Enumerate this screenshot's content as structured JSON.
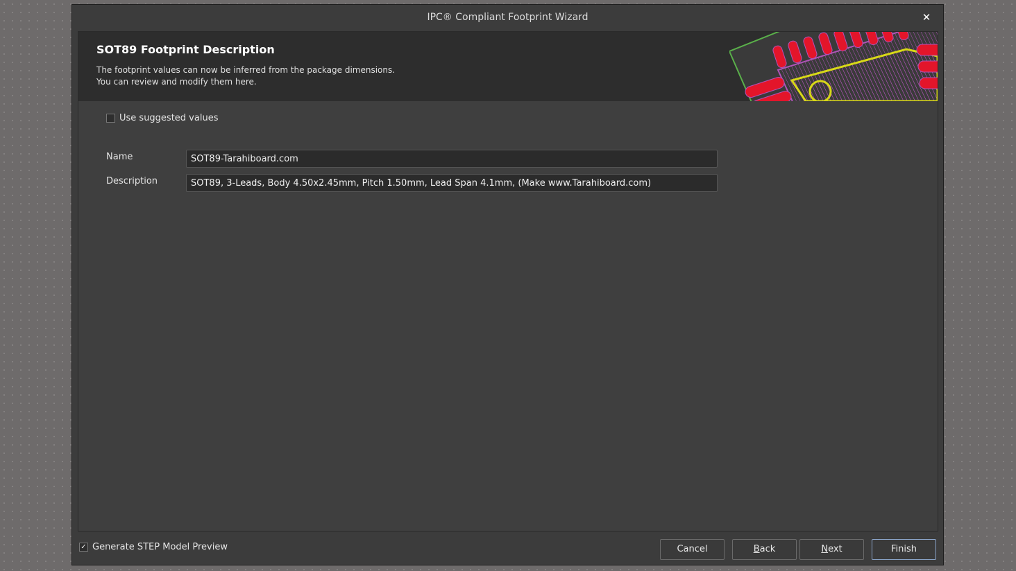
{
  "window": {
    "title": "IPC® Compliant Footprint Wizard"
  },
  "header": {
    "title": "SOT89 Footprint Description",
    "description_line1": "The footprint values can now be inferred from the package dimensions.",
    "description_line2": "You can review and modify them here."
  },
  "suggested": {
    "label": "Use suggested values",
    "checked": false
  },
  "fields": {
    "name": {
      "label": "Name",
      "value": "SOT89-Tarahiboard.com"
    },
    "description": {
      "label": "Description",
      "value": "SOT89, 3-Leads, Body 4.50x2.45mm, Pitch 1.50mm, Lead Span 4.1mm, (Make www.Tarahiboard.com)"
    }
  },
  "step_preview": {
    "label": "Generate STEP Model Preview",
    "checked": true
  },
  "buttons": {
    "cancel": "Cancel",
    "back_mnemonic": "B",
    "back_rest": "ack",
    "next_mnemonic": "N",
    "next_rest": "ext",
    "finish": "Finish"
  },
  "icons": {
    "close": "close-icon",
    "check": "check-icon"
  },
  "colors": {
    "pad": "#e3152a",
    "silkscreen": "#d8d818",
    "outline": "#5ab04a",
    "courtyard": "#b054b8"
  }
}
